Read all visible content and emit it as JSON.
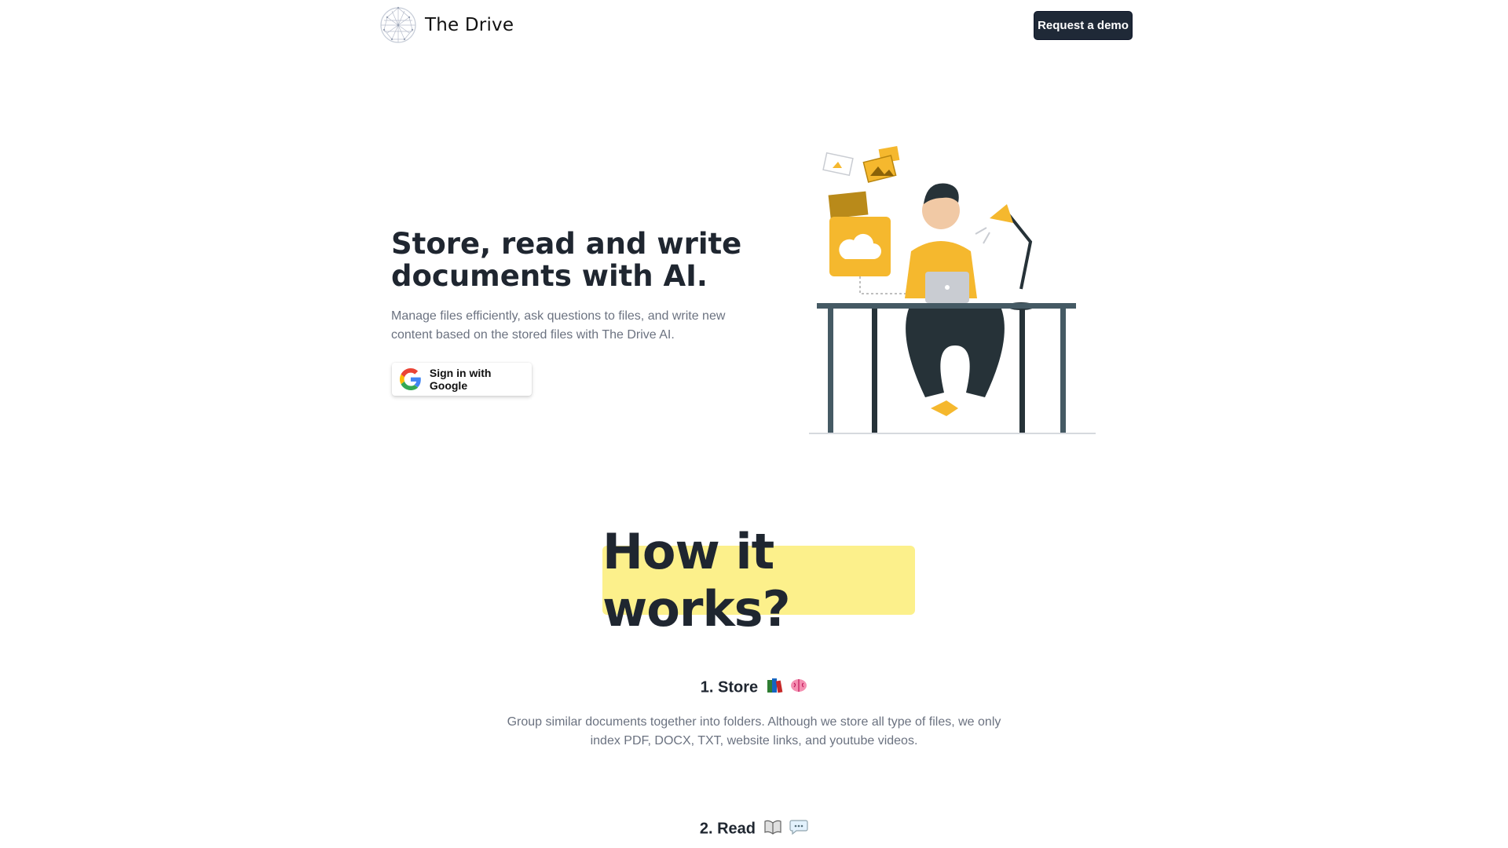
{
  "header": {
    "brand_name": "The Drive",
    "demo_button": "Request a demo"
  },
  "hero": {
    "title": "Store, read and write documents with AI.",
    "description": "Manage files efficiently, ask questions to files, and write new content based on the stored files with The Drive AI.",
    "google_button": "Sign in with Google"
  },
  "how_it_works": {
    "title": "How it works?",
    "steps": [
      {
        "title": "1. Store",
        "icons": [
          "books-icon",
          "brain-icon"
        ],
        "description": "Group similar documents together into folders. Although we store all type of files, we only index PDF, DOCX, TXT, website links, and youtube videos."
      },
      {
        "title": "2. Read",
        "icons": [
          "open-book-icon",
          "speech-bubble-icon"
        ]
      }
    ]
  },
  "colors": {
    "accent_yellow": "#f5b82e",
    "highlight": "#fcf08b",
    "dark_button": "#1f2937"
  }
}
